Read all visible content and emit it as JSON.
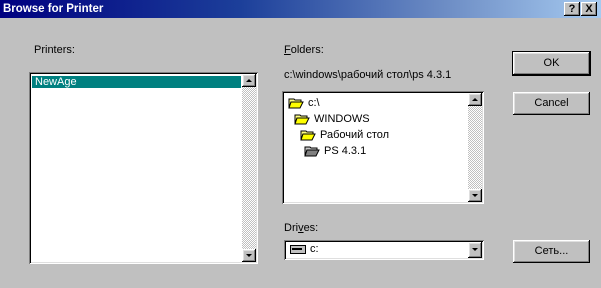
{
  "window": {
    "title": "Browse for Printer",
    "help_label": "?",
    "close_label": "X"
  },
  "printers": {
    "label_text": "Printers:",
    "items": [
      "NewAge"
    ]
  },
  "folders": {
    "label_letter": "F",
    "label_rest": "olders:",
    "path": "c:\\windows\\рабочий стол\\ps 4.3.1",
    "tree": [
      "c:\\",
      "WINDOWS",
      "Рабочий стол",
      "PS 4.3.1"
    ]
  },
  "drives": {
    "label_pre": "Dri",
    "label_letter": "v",
    "label_post": "es:",
    "value": "c:"
  },
  "buttons": {
    "ok": "OK",
    "cancel": "Cancel",
    "network": "Сеть..."
  }
}
